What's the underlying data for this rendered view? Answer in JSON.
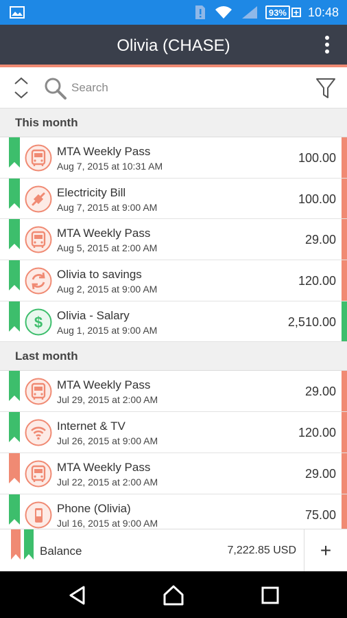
{
  "status_bar": {
    "time": "10:48",
    "battery": "93%",
    "battery_plus": "+"
  },
  "app_bar": {
    "title": "Olivia (CHASE)",
    "menu_icon": "overflow-menu-icon"
  },
  "toolbar": {
    "search_placeholder": "Search",
    "sort_icon": "sort-icon",
    "search_icon": "search-icon",
    "filter_icon": "filter-icon"
  },
  "sections": [
    {
      "title": "This month",
      "items": [
        {
          "name": "MTA Weekly Pass",
          "date": "Aug 7, 2015 at 10:31 AM",
          "amount": "100.00",
          "icon": "bus-icon",
          "flag": "green",
          "bar": "expense"
        },
        {
          "name": "Electricity Bill",
          "date": "Aug 7, 2015 at 9:00 AM",
          "amount": "100.00",
          "icon": "plug-icon",
          "flag": "green",
          "bar": "expense"
        },
        {
          "name": "MTA Weekly Pass",
          "date": "Aug 5, 2015 at 2:00 AM",
          "amount": "29.00",
          "icon": "bus-icon",
          "flag": "green",
          "bar": "expense"
        },
        {
          "name": "Olivia to savings",
          "date": "Aug 2, 2015 at 9:00 AM",
          "amount": "120.00",
          "icon": "transfer-icon",
          "flag": "green",
          "bar": "expense"
        },
        {
          "name": "Olivia - Salary",
          "date": "Aug 1, 2015 at 9:00 AM",
          "amount": "2,510.00",
          "icon": "dollar-icon",
          "flag": "green",
          "bar": "income"
        }
      ]
    },
    {
      "title": "Last month",
      "items": [
        {
          "name": "MTA Weekly Pass",
          "date": "Jul 29, 2015 at 2:00 AM",
          "amount": "29.00",
          "icon": "bus-icon",
          "flag": "green",
          "bar": "expense"
        },
        {
          "name": "Internet & TV",
          "date": "Jul 26, 2015 at 9:00 AM",
          "amount": "120.00",
          "icon": "wifi-icon",
          "flag": "green",
          "bar": "expense"
        },
        {
          "name": "MTA Weekly Pass",
          "date": "Jul 22, 2015 at 2:00 AM",
          "amount": "29.00",
          "icon": "bus-icon",
          "flag": "red",
          "bar": "expense"
        },
        {
          "name": "Phone (Olivia)",
          "date": "Jul 16, 2015 at 9:00 AM",
          "amount": "75.00",
          "icon": "phone-icon",
          "flag": "green",
          "bar": "expense"
        }
      ]
    }
  ],
  "footer": {
    "balance_label": "Balance",
    "balance_value": "7,222.85 USD",
    "add_label": "+"
  },
  "colors": {
    "status_bar": "#1E88E5",
    "app_bar": "#3A3F4B",
    "accent": "#F08A73",
    "expense": "#F08A73",
    "income": "#3DBE6C",
    "flag_green": "#3DBE6C",
    "flag_red": "#F08A73"
  }
}
